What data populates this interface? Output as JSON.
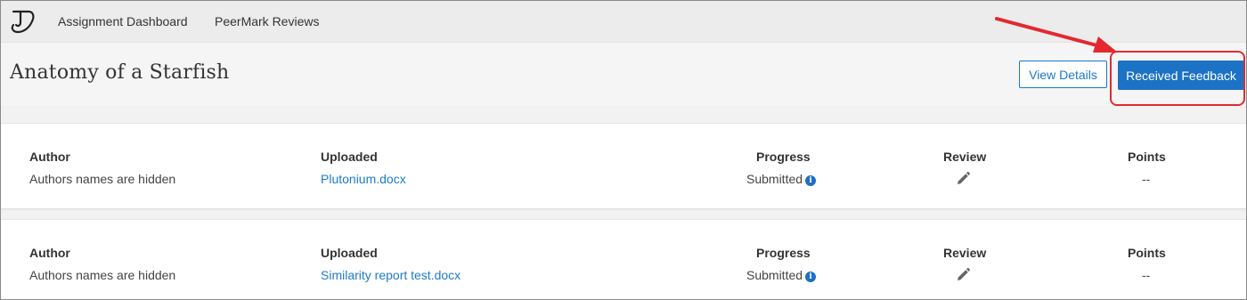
{
  "nav": {
    "assignment_dashboard": "Assignment Dashboard",
    "peermark_reviews": "PeerMark Reviews"
  },
  "header": {
    "title": "Anatomy of a Starfish",
    "view_details": "View Details",
    "received_feedback": "Received Feedback"
  },
  "columns": {
    "author": "Author",
    "uploaded": "Uploaded",
    "progress": "Progress",
    "review": "Review",
    "points": "Points"
  },
  "rows": [
    {
      "author": "Authors names are hidden",
      "uploaded": "Plutonium.docx",
      "progress": "Submitted",
      "points": "--"
    },
    {
      "author": "Authors names are hidden",
      "uploaded": "Similarity report test.docx",
      "progress": "Submitted",
      "points": "--"
    }
  ],
  "colors": {
    "accent": "#1c72c4",
    "link": "#1f7bc7",
    "annotation": "#e3292f"
  },
  "icons": [
    "turnitin-logo-icon",
    "info-icon",
    "pencil-icon",
    "annotation-arrow"
  ]
}
